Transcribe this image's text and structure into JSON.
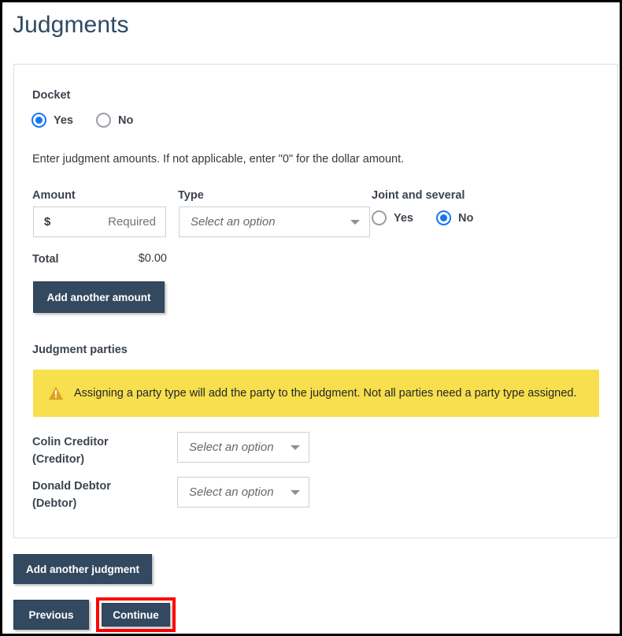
{
  "page": {
    "title": "Judgments"
  },
  "docket": {
    "label": "Docket",
    "options": [
      {
        "label": "Yes",
        "selected": true
      },
      {
        "label": "No",
        "selected": false
      }
    ]
  },
  "instructions": "Enter judgment amounts. If not applicable, enter \"0\" for the dollar amount.",
  "amount_section": {
    "amount_label": "Amount",
    "amount_prefix": "$",
    "amount_placeholder": "Required",
    "amount_value": "",
    "type_label": "Type",
    "type_placeholder": "Select an option",
    "type_value": "",
    "joint_label": "Joint and several",
    "joint_options": [
      {
        "label": "Yes",
        "selected": false
      },
      {
        "label": "No",
        "selected": true
      }
    ],
    "total_label": "Total",
    "total_value": "$0.00",
    "add_amount_label": "Add another amount"
  },
  "parties_section": {
    "heading": "Judgment parties",
    "warning_icon": "warning-triangle-icon",
    "warning_text": "Assigning a party type will add the party to the judgment. Not all parties need a party type assigned.",
    "rows": [
      {
        "name": "Colin Creditor",
        "role": "(Creditor)",
        "select_placeholder": "Select an option",
        "select_value": ""
      },
      {
        "name": "Donald Debtor",
        "role": "(Debtor)",
        "select_placeholder": "Select an option",
        "select_value": ""
      }
    ]
  },
  "footer": {
    "add_judgment_label": "Add another judgment",
    "previous_label": "Previous",
    "continue_label": "Continue"
  },
  "colors": {
    "title_text": "#2e4a62",
    "button_dark": "#33495f",
    "radio_accent": "#1477f0",
    "warning_background": "#f7df4e",
    "warning_icon": "#d8a323",
    "highlight_outline": "#ff0000",
    "page_border": "#000000",
    "card_border": "#dededf"
  }
}
